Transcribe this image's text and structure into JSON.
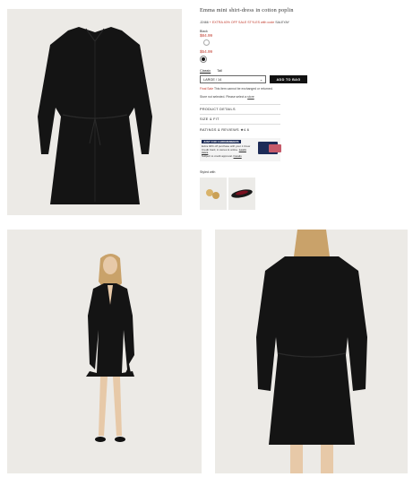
{
  "product": {
    "title": "Emma mini shirt-dress in cotton poplin",
    "promo_code_label": "J2466",
    "promo_text": "+ EXTRA 40% OFF SALE STYLES with code",
    "promo_code": "SALEYAY",
    "color_label": "Black",
    "original_price": "$84.99",
    "sale_price": "$54.99",
    "tabs": [
      "Classic",
      "Tall"
    ],
    "size_value": "LARGE / 14",
    "add_button": "ADD TO BAG",
    "final_sale_label": "Final Sale",
    "final_sale_text": "This item cannot be exchanged or returned.",
    "store_text": "Store not selected. Please select a",
    "store_link": "store",
    "accordions": [
      "PRODUCT DETAILS",
      "SIZE & FIT",
      "RATINGS & REVIEWS"
    ],
    "ratings_stars": "★4.6",
    "card_header": "JUST FOR CARDMEMBERS",
    "card_text": "Extra 40% off purchase with your J.Crew Credit Card, in stores & online.",
    "card_link": "Learn more",
    "card_footer_text": "Subject to credit approval.",
    "card_footer_link": "Details",
    "styled_with": "Styled with"
  },
  "colors": {
    "sale_red": "#c0392b",
    "dress_black": "#141414",
    "panel_bg": "#eceae6"
  }
}
